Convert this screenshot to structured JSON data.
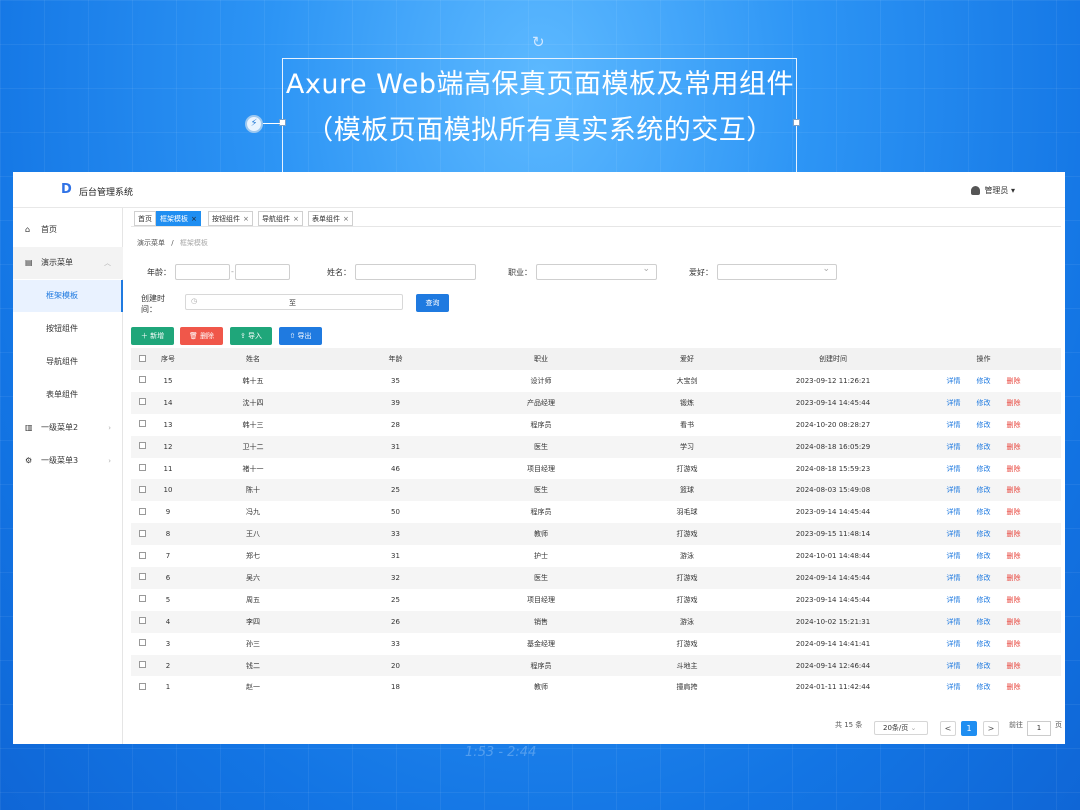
{
  "headline": {
    "line1": "Axure Web端高保真页面模板及常用组件",
    "line2": "（模板页面模拟所有真实系统的交互）"
  },
  "app": {
    "title": "后台管理系统",
    "user": "管理员"
  },
  "sidebar": {
    "items": [
      {
        "label": "首页",
        "icon": "home-icon"
      },
      {
        "label": "演示菜单",
        "icon": "document-icon"
      },
      {
        "label": "框架模板"
      },
      {
        "label": "按钮组件"
      },
      {
        "label": "导航组件"
      },
      {
        "label": "表单组件"
      },
      {
        "label": "一级菜单2",
        "icon": "bar-chart-icon"
      },
      {
        "label": "一级菜单3",
        "icon": "settings-icon"
      }
    ]
  },
  "tabs": [
    "首页",
    "框架模板",
    "按钮组件",
    "导航组件",
    "表单组件"
  ],
  "breadcrumb": {
    "parent": "演示菜单",
    "sep": "/",
    "current": "框架模板"
  },
  "filters": {
    "age_label": "年龄：",
    "name_label": "姓名：",
    "job_label": "职业：",
    "hobby_label": "爱好：",
    "created_label_1": "创建时",
    "created_label_2": "间：",
    "date_to": "至",
    "query": "查询"
  },
  "actions": {
    "add": "新增",
    "delete": "删除",
    "import": "导入",
    "export": "导出"
  },
  "table": {
    "headers": [
      "序号",
      "姓名",
      "年龄",
      "职业",
      "爱好",
      "创建时间",
      "操作"
    ],
    "op_detail": "详情",
    "op_edit": "修改",
    "op_delete": "删除",
    "rows": [
      [
        "15",
        "韩十五",
        "35",
        "设计师",
        "大宝剑",
        "2023-09-12 11:26:21"
      ],
      [
        "14",
        "沈十四",
        "39",
        "产品经理",
        "锻炼",
        "2023-09-14 14:45:44"
      ],
      [
        "13",
        "韩十三",
        "28",
        "程序员",
        "看书",
        "2024-10-20 08:28:27"
      ],
      [
        "12",
        "卫十二",
        "31",
        "医生",
        "学习",
        "2024-08-18 16:05:29"
      ],
      [
        "11",
        "褚十一",
        "46",
        "项目经理",
        "打游戏",
        "2024-08-18 15:59:23"
      ],
      [
        "10",
        "陈十",
        "25",
        "医生",
        "篮球",
        "2024-08-03 15:49:08"
      ],
      [
        "9",
        "冯九",
        "50",
        "程序员",
        "羽毛球",
        "2023-09-14 14:45:44"
      ],
      [
        "8",
        "王八",
        "33",
        "教师",
        "打游戏",
        "2023-09-15 11:48:14"
      ],
      [
        "7",
        "郑七",
        "31",
        "护士",
        "游泳",
        "2024-10-01 14:48:44"
      ],
      [
        "6",
        "吴六",
        "32",
        "医生",
        "打游戏",
        "2024-09-14 14:45:44"
      ],
      [
        "5",
        "周五",
        "25",
        "项目经理",
        "打游戏",
        "2023-09-14 14:45:44"
      ],
      [
        "4",
        "李四",
        "26",
        "销售",
        "游泳",
        "2024-10-02 15:21:31"
      ],
      [
        "3",
        "孙三",
        "33",
        "基金经理",
        "打游戏",
        "2024-09-14 14:41:41"
      ],
      [
        "2",
        "钱二",
        "20",
        "程序员",
        "斗地主",
        "2024-09-14 12:46:44"
      ],
      [
        "1",
        "赵一",
        "18",
        "教师",
        "撞肩挎",
        "2024-01-11 11:42:44"
      ]
    ]
  },
  "pager": {
    "total": "共 15 条",
    "page_size": "20条/页",
    "current": "1",
    "prev": "<",
    "next": ">",
    "goto_label": "前往",
    "goto_value": "1",
    "page_unit": "页"
  },
  "decor_text": "1:53 - 2:44"
}
